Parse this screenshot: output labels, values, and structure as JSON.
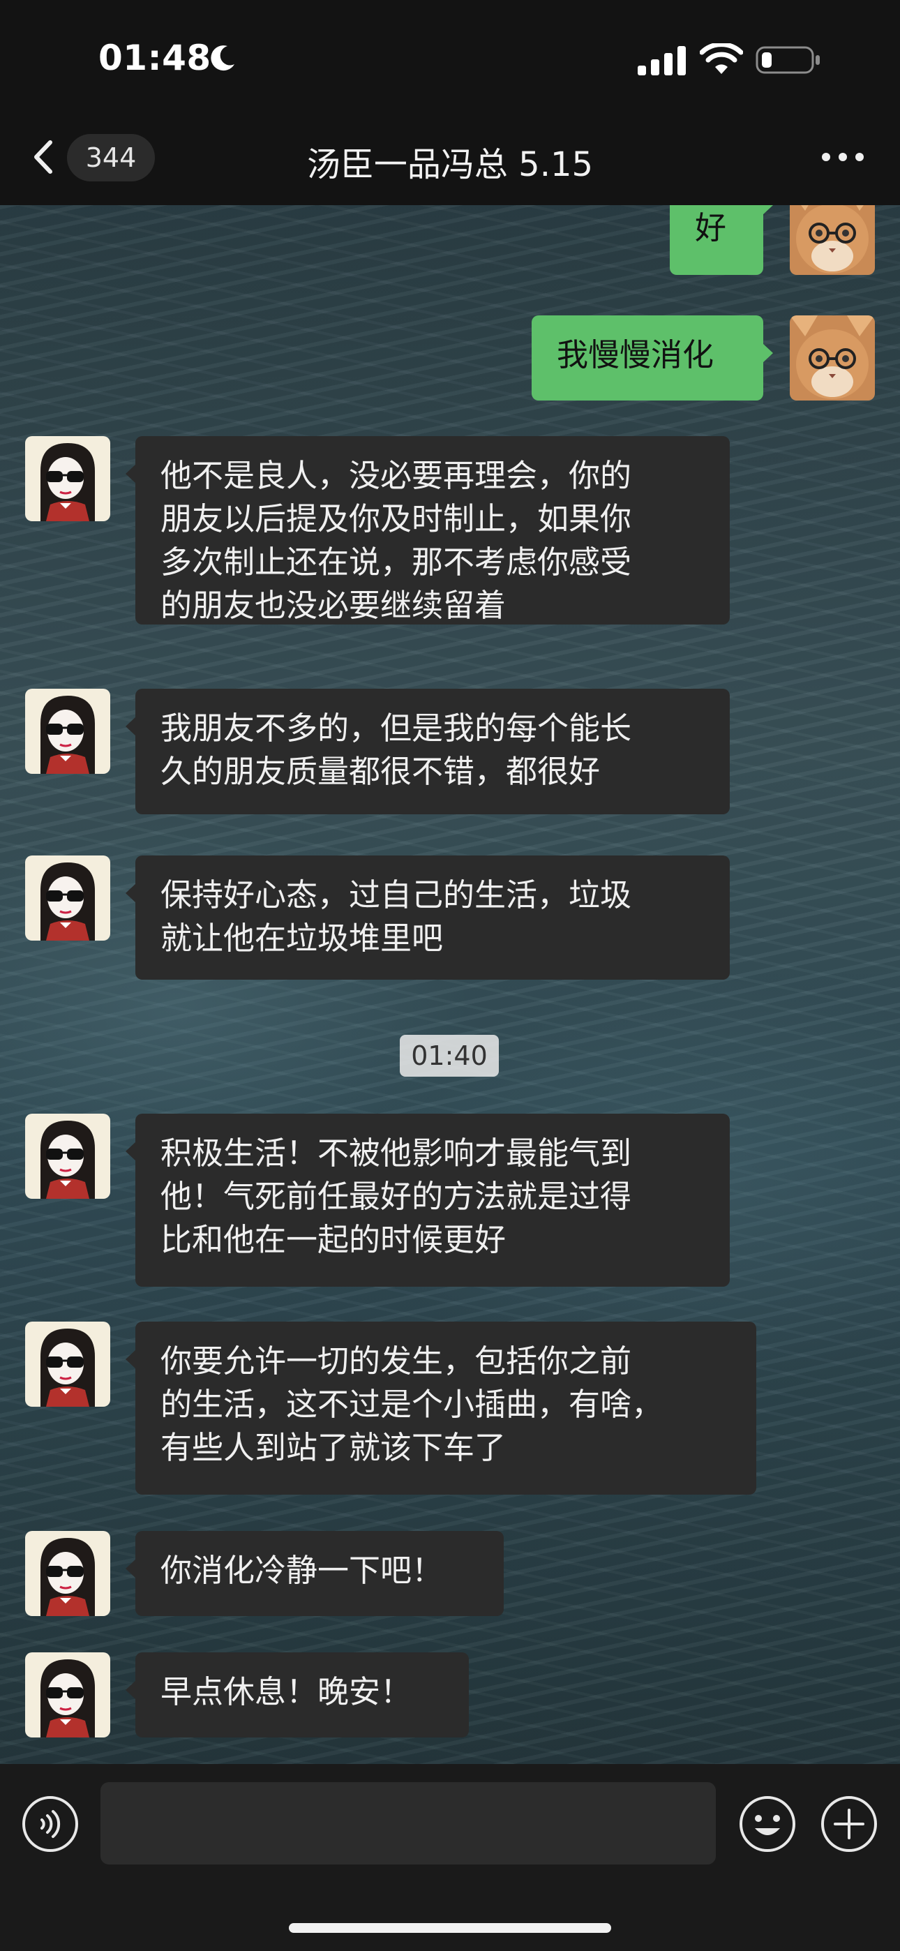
{
  "status_bar": {
    "time": "01:48",
    "icons": [
      "moon-icon",
      "signal-icon",
      "wifi-icon",
      "battery-icon"
    ]
  },
  "header": {
    "back_icon": "chevron-left-icon",
    "unread_count": "344",
    "title": "汤臣一品冯总 5.15",
    "more_icon": "more-dots-icon"
  },
  "messages": [
    {
      "side": "out",
      "text": "好"
    },
    {
      "side": "out",
      "text": "我慢慢消化"
    },
    {
      "side": "in",
      "text": "他不是良人，没必要再理会，你的\n朋友以后提及你及时制止，如果你\n多次制止还在说，那不考虑你感受\n的朋友也没必要继续留着"
    },
    {
      "side": "in",
      "text": "我朋友不多的，但是我的每个能长\n久的朋友质量都很不错，都很好"
    },
    {
      "side": "in",
      "text": "保持好心态，过自己的生活，垃圾\n就让他在垃圾堆里吧"
    },
    {
      "side": "in",
      "text": "积极生活！不被他影响才最能气到\n他！气死前任最好的方法就是过得\n比和他在一起的时候更好"
    },
    {
      "side": "in",
      "text": "你要允许一切的发生，包括你之前\n的生活，这不过是个小插曲，有啥，\n有些人到站了就该下车了"
    },
    {
      "side": "in",
      "text": "你消化冷静一下吧！"
    },
    {
      "side": "in",
      "text": "早点休息！晚安！"
    }
  ],
  "timestamp": "01:40",
  "input_bar": {
    "voice_icon": "voice-icon",
    "placeholder": "",
    "emoji_icon": "emoji-icon",
    "plus_icon": "plus-icon"
  },
  "colors": {
    "outgoing_bubble": "#5ec06a",
    "incoming_bubble": "#2b2b2b",
    "header_bg": "#131313"
  }
}
